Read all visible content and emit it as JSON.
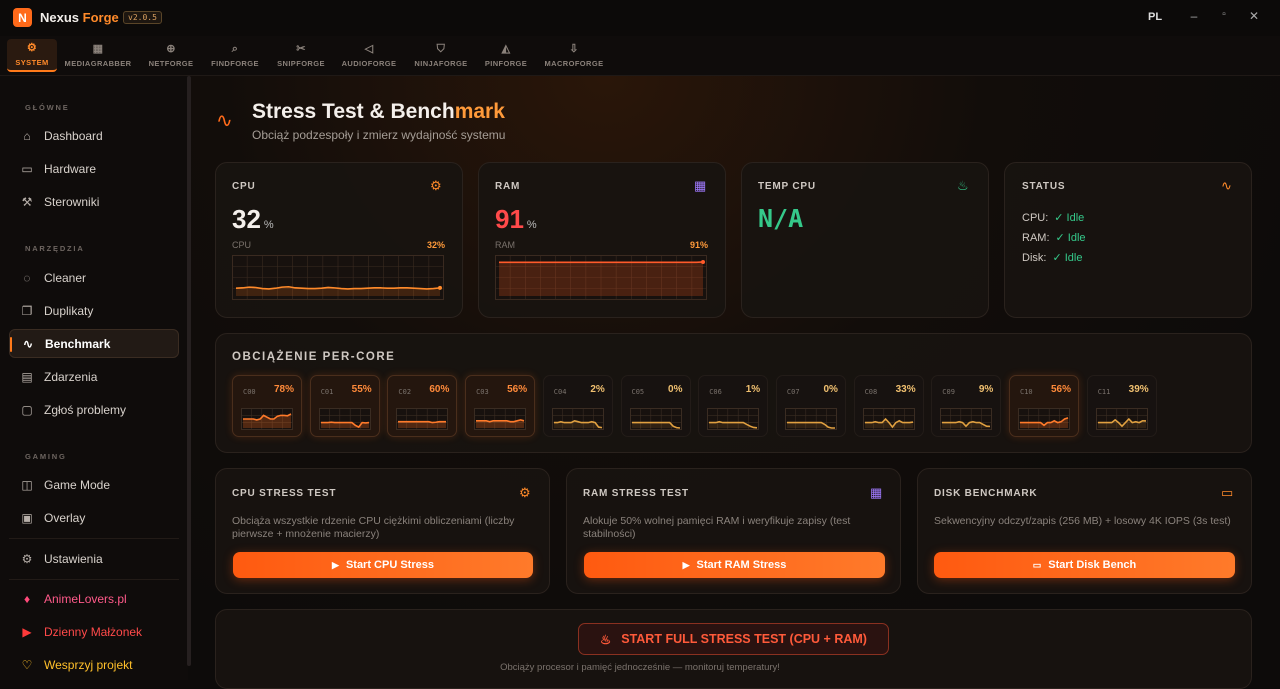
{
  "app": {
    "logo_letter": "N",
    "name_part1": "Nexus",
    "name_part2": "Forge",
    "version": "v2.0.5",
    "lang": "PL",
    "win_min": "–",
    "win_max": "▫",
    "win_close": "✕"
  },
  "nav": [
    {
      "label": "SYSTEM",
      "icon": "⚙"
    },
    {
      "label": "MEDIAGRABBER",
      "icon": "▦"
    },
    {
      "label": "NETFORGE",
      "icon": "⊕"
    },
    {
      "label": "FINDFORGE",
      "icon": "⌕"
    },
    {
      "label": "SNIPFORGE",
      "icon": "✂"
    },
    {
      "label": "AUDIOFORGE",
      "icon": "◁"
    },
    {
      "label": "NINJAFORGE",
      "icon": "⛉"
    },
    {
      "label": "PINFORGE",
      "icon": "◭"
    },
    {
      "label": "MACROFORGE",
      "icon": "⇩"
    }
  ],
  "sidebar": {
    "sec1": "GŁÓWNE",
    "sec2": "NARZĘDZIA",
    "sec3": "GAMING",
    "items": [
      {
        "label": "Dashboard",
        "icon": "⌂"
      },
      {
        "label": "Hardware",
        "icon": "▭"
      },
      {
        "label": "Sterowniki",
        "icon": "⚒"
      },
      {
        "label": "Cleaner",
        "icon": "◌"
      },
      {
        "label": "Duplikaty",
        "icon": "❐"
      },
      {
        "label": "Benchmark",
        "icon": "∿"
      },
      {
        "label": "Zdarzenia",
        "icon": "▤"
      },
      {
        "label": "Zgłoś problemy",
        "icon": "▢"
      },
      {
        "label": "Game Mode",
        "icon": "◫"
      },
      {
        "label": "Overlay",
        "icon": "▣"
      },
      {
        "label": "Ustawienia",
        "icon": "⚙"
      },
      {
        "label": "AnimeLovers.pl",
        "icon": "♦"
      },
      {
        "label": "Dzienny Małżonek",
        "icon": "▶"
      },
      {
        "label": "Wesprzyj projekt",
        "icon": "♡"
      }
    ]
  },
  "page": {
    "title_a": "Stress Test & Bench",
    "title_b": "mark",
    "subtitle": "Obciąż podzespoły i zmierz wydajność systemu",
    "icon": "∿"
  },
  "cpu": {
    "label": "CPU",
    "value": "32",
    "unit": "%",
    "small_label": "CPU",
    "small_pct": "32%",
    "icon": "⚙",
    "history": [
      0.21,
      0.22,
      0.24,
      0.23,
      0.2,
      0.19,
      0.21,
      0.24,
      0.25,
      0.22,
      0.21,
      0.2,
      0.2,
      0.21,
      0.23,
      0.22,
      0.2,
      0.19,
      0.2,
      0.2,
      0.21,
      0.22,
      0.22,
      0.21,
      0.21,
      0.22,
      0.22,
      0.21,
      0.2,
      0.19,
      0.2,
      0.22
    ]
  },
  "ram": {
    "label": "RAM",
    "value": "91",
    "unit": "%",
    "small_label": "RAM",
    "small_pct": "91%",
    "icon": "▦",
    "history": [
      0.91,
      0.91,
      0.91,
      0.91,
      0.91,
      0.91,
      0.91,
      0.91,
      0.91,
      0.91,
      0.91,
      0.91,
      0.91,
      0.91,
      0.91,
      0.91,
      0.91,
      0.91,
      0.91,
      0.91,
      0.91,
      0.91,
      0.91,
      0.91,
      0.91,
      0.91,
      0.91,
      0.91,
      0.91,
      0.91,
      0.91,
      0.92
    ]
  },
  "temp": {
    "label": "TEMP CPU",
    "value": "N/A",
    "icon": "♨"
  },
  "status": {
    "label": "STATUS",
    "icon": "∿",
    "rows": [
      {
        "name": "CPU:",
        "state": "✓ Idle"
      },
      {
        "name": "RAM:",
        "state": "✓ Idle"
      },
      {
        "name": "Disk:",
        "state": "✓ Idle"
      }
    ]
  },
  "percore": {
    "title": "OBCIĄŻENIE PER-CORE",
    "cores": [
      {
        "name": "C00",
        "pct": "78%",
        "value": 0.78,
        "hot": true,
        "history": [
          0.5,
          0.5,
          0.5,
          0.5,
          0.45,
          0.5,
          0.7,
          0.6,
          0.5,
          0.5,
          0.65,
          0.7,
          0.7,
          0.68,
          0.78
        ]
      },
      {
        "name": "C01",
        "pct": "55%",
        "value": 0.55,
        "hot": true,
        "history": [
          0.3,
          0.3,
          0.3,
          0.32,
          0.3,
          0.3,
          0.3,
          0.3,
          0.3,
          0.3,
          0.15,
          0.05,
          0.3,
          0.28,
          0.3
        ]
      },
      {
        "name": "C02",
        "pct": "60%",
        "value": 0.6,
        "hot": true,
        "history": [
          0.35,
          0.35,
          0.35,
          0.35,
          0.35,
          0.35,
          0.35,
          0.35,
          0.35,
          0.35,
          0.3,
          0.32,
          0.35,
          0.35,
          0.35
        ]
      },
      {
        "name": "C03",
        "pct": "56%",
        "value": 0.56,
        "hot": true,
        "history": [
          0.4,
          0.4,
          0.4,
          0.4,
          0.35,
          0.4,
          0.4,
          0.4,
          0.4,
          0.4,
          0.35,
          0.35,
          0.4,
          0.45,
          0.4
        ]
      },
      {
        "name": "C04",
        "pct": "2%",
        "value": 0.02,
        "hot": false,
        "history": [
          0.3,
          0.3,
          0.35,
          0.3,
          0.3,
          0.3,
          0.4,
          0.35,
          0.3,
          0.3,
          0.3,
          0.35,
          0.3,
          0.05,
          0.02
        ]
      },
      {
        "name": "C05",
        "pct": "0%",
        "value": 0.0,
        "hot": false,
        "history": [
          0.3,
          0.3,
          0.3,
          0.3,
          0.3,
          0.3,
          0.3,
          0.3,
          0.3,
          0.3,
          0.3,
          0.3,
          0.1,
          0.02,
          0.0
        ]
      },
      {
        "name": "C06",
        "pct": "1%",
        "value": 0.01,
        "hot": false,
        "history": [
          0.3,
          0.3,
          0.3,
          0.35,
          0.3,
          0.3,
          0.3,
          0.3,
          0.3,
          0.3,
          0.3,
          0.2,
          0.1,
          0.03,
          0.01
        ]
      },
      {
        "name": "C07",
        "pct": "0%",
        "value": 0.0,
        "hot": false,
        "history": [
          0.3,
          0.3,
          0.3,
          0.3,
          0.3,
          0.3,
          0.3,
          0.3,
          0.3,
          0.3,
          0.3,
          0.2,
          0.05,
          0.0,
          0.0
        ]
      },
      {
        "name": "C08",
        "pct": "33%",
        "value": 0.33,
        "hot": false,
        "history": [
          0.3,
          0.3,
          0.3,
          0.35,
          0.3,
          0.3,
          0.5,
          0.3,
          0.05,
          0.3,
          0.4,
          0.3,
          0.3,
          0.3,
          0.33
        ]
      },
      {
        "name": "C09",
        "pct": "9%",
        "value": 0.09,
        "hot": false,
        "history": [
          0.3,
          0.3,
          0.3,
          0.3,
          0.3,
          0.35,
          0.3,
          0.1,
          0.3,
          0.35,
          0.3,
          0.3,
          0.2,
          0.1,
          0.09
        ]
      },
      {
        "name": "C10",
        "pct": "56%",
        "value": 0.56,
        "hot": true,
        "history": [
          0.3,
          0.3,
          0.3,
          0.3,
          0.3,
          0.3,
          0.3,
          0.15,
          0.3,
          0.3,
          0.4,
          0.3,
          0.35,
          0.5,
          0.56
        ]
      },
      {
        "name": "C11",
        "pct": "39%",
        "value": 0.39,
        "hot": false,
        "history": [
          0.3,
          0.3,
          0.3,
          0.3,
          0.3,
          0.45,
          0.3,
          0.1,
          0.3,
          0.5,
          0.3,
          0.35,
          0.3,
          0.4,
          0.39
        ]
      }
    ]
  },
  "tests": [
    {
      "label": "CPU STRESS TEST",
      "icon": "⚙",
      "desc": "Obciąża wszystkie rdzenie CPU ciężkimi obliczeniami (liczby pierwsze + mnożenie macierzy)",
      "button": "Start CPU Stress",
      "btn_icon": "▶"
    },
    {
      "label": "RAM STRESS TEST",
      "icon": "▦",
      "desc": "Alokuje 50% wolnej pamięci RAM i weryfikuje zapisy (test stabilności)",
      "button": "Start RAM Stress",
      "btn_icon": "▶"
    },
    {
      "label": "DISK BENCHMARK",
      "icon": "▭",
      "desc": "Sekwencyjny odczyt/zapis (256 MB) + losowy 4K IOPS (3s test)",
      "button": "Start Disk Bench",
      "btn_icon": "▭"
    }
  ],
  "full": {
    "button": "START FULL STRESS TEST (CPU + RAM)",
    "icon": "♨",
    "note": "Obciąży procesor i pamięć jednocześnie — monitoruj temperatury!"
  },
  "colors": {
    "accent": "#ff7a1a",
    "ram": "#ff4a4a",
    "temp": "#35c98a",
    "ok": "#35c98a"
  }
}
